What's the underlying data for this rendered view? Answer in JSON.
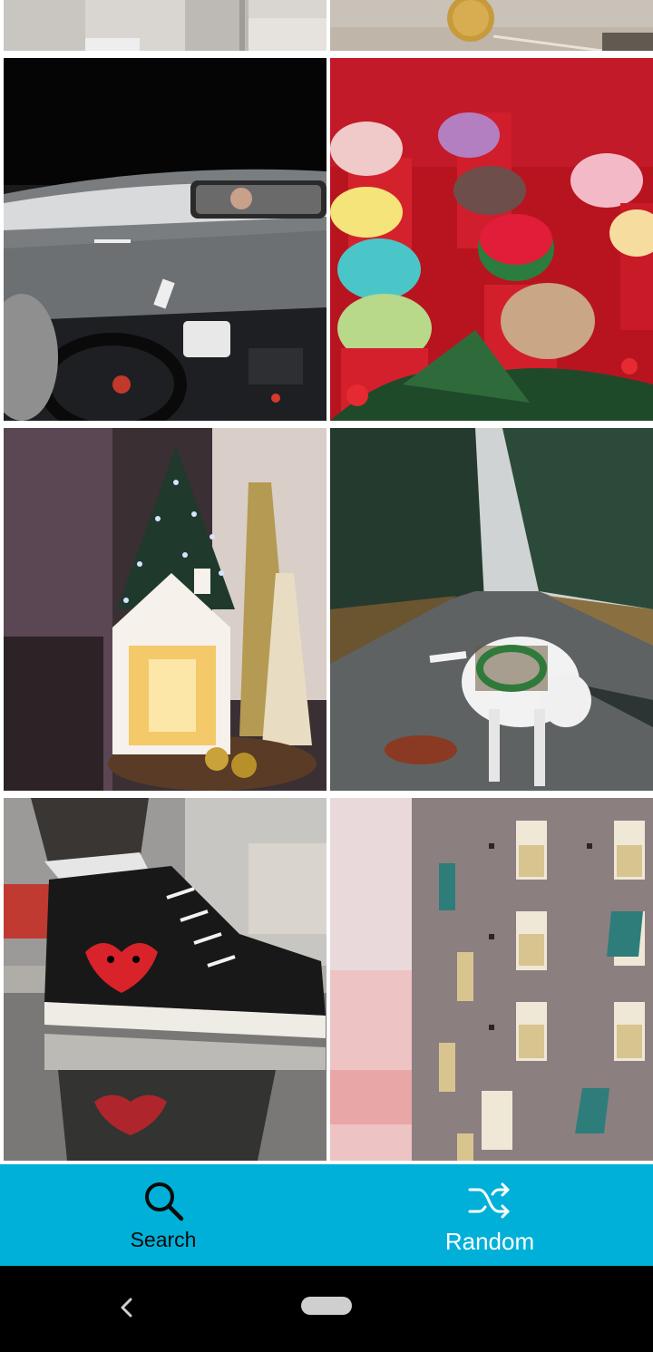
{
  "accent_color": "#00b0d8",
  "gallery": {
    "photos": [
      {
        "id": "photo-1",
        "subject": "room-corner"
      },
      {
        "id": "photo-2",
        "subject": "coin-on-table"
      },
      {
        "id": "photo-3",
        "subject": "car-interior-road"
      },
      {
        "id": "photo-4",
        "subject": "macarons"
      },
      {
        "id": "photo-5",
        "subject": "christmas-lantern"
      },
      {
        "id": "photo-6",
        "subject": "dog-forest-road"
      },
      {
        "id": "photo-7",
        "subject": "sneaker-reflection"
      },
      {
        "id": "photo-8",
        "subject": "brick-building-windows"
      }
    ]
  },
  "bottom_nav": {
    "search_label": "Search",
    "random_label": "Random",
    "search_icon": "search-icon",
    "random_icon": "shuffle-icon"
  },
  "system_nav": {
    "back_icon": "back-chevron-icon",
    "home_icon": "home-pill-icon"
  }
}
